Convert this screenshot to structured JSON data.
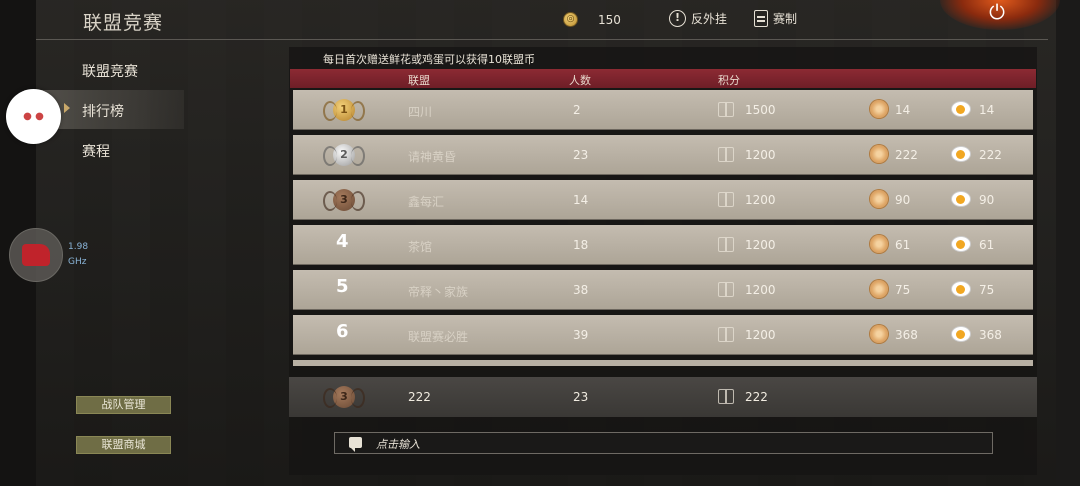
{
  "header": {
    "title": "联盟竞赛",
    "coin_icon": "coin-icon",
    "coin_value": "150",
    "anti_cheat_label": "反外挂",
    "rules_label": "赛制"
  },
  "sidebar": {
    "items": [
      {
        "label": "联盟竞赛"
      },
      {
        "label": "排行榜"
      },
      {
        "label": "赛程"
      }
    ],
    "team_manage_label": "战队管理",
    "alliance_shop_label": "联盟商城"
  },
  "overlay": {
    "cpu_line1": "1.98",
    "cpu_line2": "GHz"
  },
  "notice": "每日首次赠送鲜花或鸡蛋可以获得10联盟币",
  "table": {
    "headers": {
      "alliance": "联盟",
      "count": "人数",
      "score": "积分"
    },
    "rows": [
      {
        "rank": "1",
        "name": "四川",
        "count": "2",
        "score": "1500",
        "flowers": "14",
        "eggs": "14"
      },
      {
        "rank": "2",
        "name": "请神黄昏",
        "count": "23",
        "score": "1200",
        "flowers": "222",
        "eggs": "222"
      },
      {
        "rank": "3",
        "name": "鑫每汇",
        "count": "14",
        "score": "1200",
        "flowers": "90",
        "eggs": "90"
      },
      {
        "rank": "4",
        "name": "茶馆",
        "count": "18",
        "score": "1200",
        "flowers": "61",
        "eggs": "61"
      },
      {
        "rank": "5",
        "name": "帝释丶家族",
        "count": "38",
        "score": "1200",
        "flowers": "75",
        "eggs": "75"
      },
      {
        "rank": "6",
        "name": "联盟赛必胜",
        "count": "39",
        "score": "1200",
        "flowers": "368",
        "eggs": "368"
      }
    ]
  },
  "my_alliance": {
    "rank": "3",
    "name": "222",
    "count": "23",
    "score": "222"
  },
  "chat": {
    "placeholder": "点击输入"
  },
  "colors": {
    "accent_red": "#8c2a33",
    "side_button": "#6f6d45",
    "power_glow": "#e05a1c"
  }
}
